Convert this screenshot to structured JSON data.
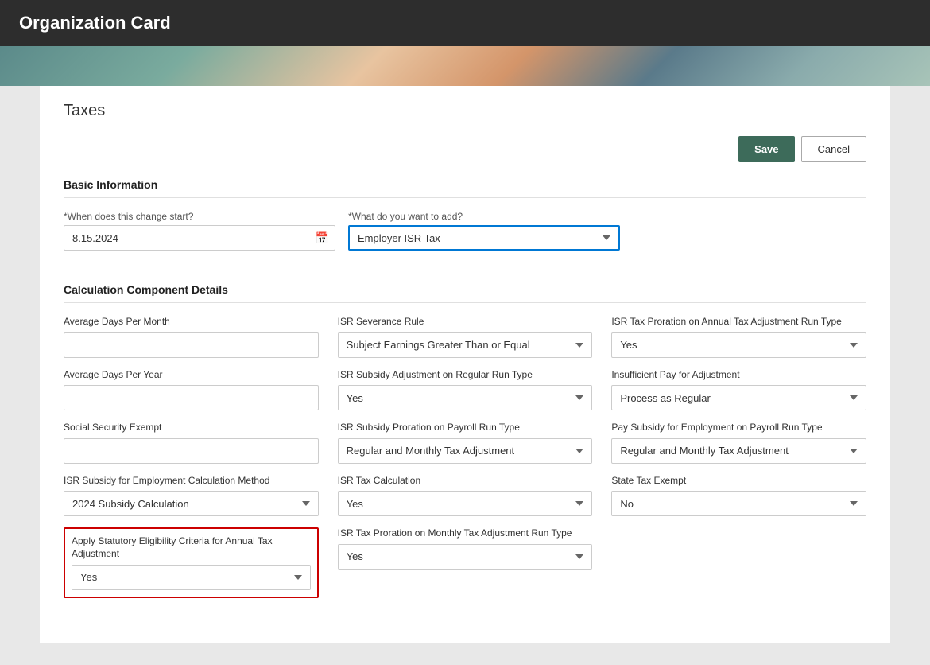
{
  "app": {
    "title": "Organization Card"
  },
  "page": {
    "title": "Taxes"
  },
  "toolbar": {
    "save_label": "Save",
    "cancel_label": "Cancel"
  },
  "basic_info": {
    "section_title": "Basic Information",
    "start_date_label": "*When does this change start?",
    "start_date_value": "8.15.2024",
    "add_label": "*What do you want to add?",
    "add_value": "Employer ISR Tax",
    "add_options": [
      "Employer ISR Tax"
    ]
  },
  "calc_details": {
    "section_title": "Calculation Component Details",
    "fields": {
      "col1": [
        {
          "label": "Average Days Per Month",
          "type": "text",
          "value": ""
        },
        {
          "label": "Average Days Per Year",
          "type": "text",
          "value": ""
        },
        {
          "label": "Social Security Exempt",
          "type": "text",
          "value": ""
        },
        {
          "label": "ISR Subsidy for Employment Calculation Method",
          "type": "select",
          "value": "2024 Subsidy Calculation",
          "options": [
            "2024 Subsidy Calculation"
          ]
        },
        {
          "label": "Apply Statutory Eligibility Criteria for Annual Tax Adjustment",
          "type": "select",
          "value": "Yes",
          "options": [
            "Yes",
            "No"
          ],
          "highlighted": true
        }
      ],
      "col2": [
        {
          "label": "ISR Severance Rule",
          "type": "select",
          "value": "Subject Earnings Greater Than or Equal",
          "options": [
            "Subject Earnings Greater Than or Equal"
          ]
        },
        {
          "label": "ISR Subsidy Adjustment on Regular Run Type",
          "type": "select",
          "value": "Yes",
          "options": [
            "Yes",
            "No"
          ]
        },
        {
          "label": "ISR Subsidy Proration on Payroll Run Type",
          "type": "select",
          "value": "Regular and Monthly Tax Adjustment",
          "options": [
            "Regular and Monthly Tax Adjustment"
          ]
        },
        {
          "label": "ISR Tax Calculation",
          "type": "select",
          "value": "Yes",
          "options": [
            "Yes",
            "No"
          ]
        },
        {
          "label": "ISR Tax Proration on Monthly Tax Adjustment Run Type",
          "type": "select",
          "value": "Yes",
          "options": [
            "Yes",
            "No"
          ]
        }
      ],
      "col3": [
        {
          "label": "ISR Tax Proration on Annual Tax Adjustment Run Type",
          "type": "select",
          "value": "Yes",
          "options": [
            "Yes",
            "No"
          ]
        },
        {
          "label": "Insufficient Pay for Adjustment",
          "type": "select",
          "value": "Process as Regular",
          "options": [
            "Process as Regular"
          ]
        },
        {
          "label": "Pay Subsidy for Employment on Payroll Run Type",
          "type": "select",
          "value": "Regular and Monthly Tax Adjustment",
          "options": [
            "Regular and Monthly Tax Adjustment"
          ]
        },
        {
          "label": "State Tax Exempt",
          "type": "select",
          "value": "No",
          "options": [
            "No",
            "Yes"
          ]
        }
      ]
    }
  }
}
